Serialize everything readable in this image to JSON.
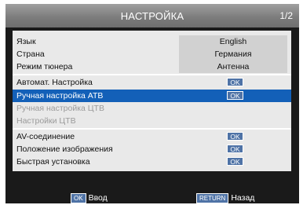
{
  "header": {
    "title": "НАСТРОЙКА",
    "page": "1/2"
  },
  "settings": [
    {
      "label": "Язык",
      "value": "English"
    },
    {
      "label": "Страна",
      "value": "Германия"
    },
    {
      "label": "Режим тюнера",
      "value": "Антенна"
    },
    {
      "label": "Автомат. Настройка",
      "button": "OK"
    },
    {
      "label": "Ручная настройка АТВ",
      "button": "OK",
      "selected": true
    },
    {
      "label": "Ручная настройка ЦТВ",
      "disabled": true
    },
    {
      "label": "Настройки ЦТВ",
      "disabled": true
    },
    {
      "label": "AV-соединение",
      "button": "OK"
    },
    {
      "label": "Положение изображения",
      "button": "OK"
    },
    {
      "label": "Быстрая установка",
      "button": "OK"
    }
  ],
  "footer": {
    "enter_key": "OK",
    "enter_label": "Ввод",
    "back_key": "RETURN",
    "back_label": "Назад"
  },
  "colors": {
    "selected": "#1360b8",
    "button": "#4f73a6",
    "panel": "#e9e9e9"
  }
}
